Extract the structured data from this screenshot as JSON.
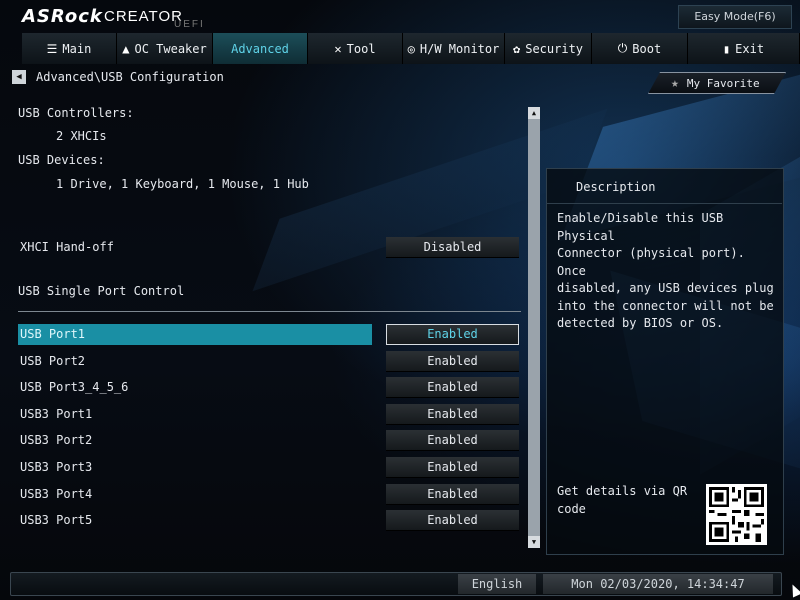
{
  "brand": {
    "logo": "ASRock",
    "product": "CREATOR",
    "sub": "UEFI"
  },
  "easy_mode": "Easy Mode(F6)",
  "tabs": [
    {
      "label": "Main",
      "icon": "list-icon"
    },
    {
      "label": "OC Tweaker",
      "icon": "rocket-icon"
    },
    {
      "label": "Advanced",
      "icon": "",
      "active": true
    },
    {
      "label": "Tool",
      "icon": "tools-icon"
    },
    {
      "label": "H/W Monitor",
      "icon": "monitor-icon"
    },
    {
      "label": "Security",
      "icon": "shield-icon"
    },
    {
      "label": "Boot",
      "icon": "power-icon"
    },
    {
      "label": "Exit",
      "icon": "exit-icon"
    }
  ],
  "breadcrumb": "Advanced\\USB Configuration",
  "favorite": "My Favorite",
  "info": {
    "controllers_label": "USB Controllers:",
    "controllers_value": "2 XHCIs",
    "devices_label": "USB Devices:",
    "devices_value": "1 Drive, 1 Keyboard, 1 Mouse, 1 Hub"
  },
  "xhci": {
    "label": "XHCI Hand-off",
    "value": "Disabled"
  },
  "section_label": "USB Single Port Control",
  "ports": [
    {
      "label": "USB Port1",
      "value": "Enabled",
      "selected": true
    },
    {
      "label": "USB Port2",
      "value": "Enabled"
    },
    {
      "label": "USB Port3_4_5_6",
      "value": "Enabled"
    },
    {
      "label": "USB3 Port1",
      "value": "Enabled"
    },
    {
      "label": "USB3 Port2",
      "value": "Enabled"
    },
    {
      "label": "USB3 Port3",
      "value": "Enabled"
    },
    {
      "label": "USB3 Port4",
      "value": "Enabled"
    },
    {
      "label": "USB3 Port5",
      "value": "Enabled"
    }
  ],
  "description": {
    "title": "Description",
    "text": "Enable/Disable this USB Physical\nConnector (physical port).  Once\ndisabled, any USB devices plug\ninto the connector will not be\ndetected by BIOS or OS.",
    "qr_text": "Get details via QR\ncode"
  },
  "footer": {
    "language": "English",
    "datetime": "Mon 02/03/2020, 14:34:47"
  }
}
